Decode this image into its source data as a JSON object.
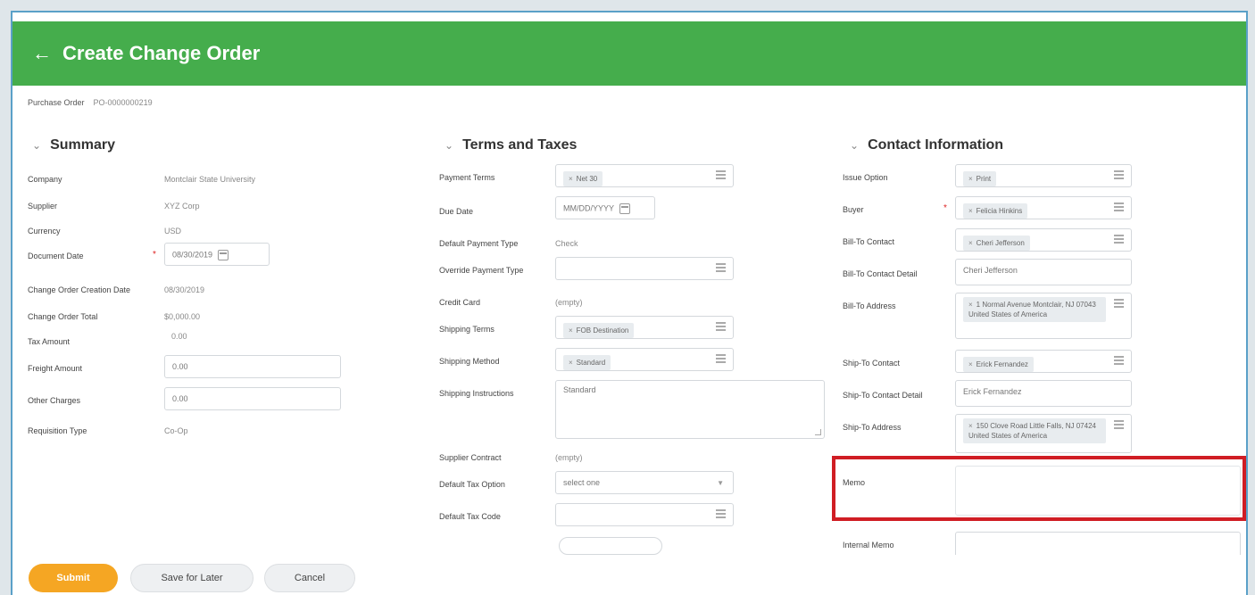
{
  "header": {
    "back_icon": "arrow-left-icon",
    "title": "Create Change Order"
  },
  "purchase_order": {
    "label": "Purchase Order",
    "value": "PO-0000000219"
  },
  "summary": {
    "title": "Summary",
    "company_label": "Company",
    "company_value": "Montclair State University",
    "supplier_label": "Supplier",
    "supplier_value": "XYZ Corp",
    "currency_label": "Currency",
    "currency_value": "USD",
    "document_date_label": "Document Date",
    "document_date_value": "08/30/2019",
    "creation_date_label": "Change Order Creation Date",
    "creation_date_value": "08/30/2019",
    "total_label": "Change Order Total",
    "total_value": "$0,000.00",
    "tax_label": "Tax Amount",
    "tax_value": "0.00",
    "freight_label": "Freight Amount",
    "freight_value": "0.00",
    "other_label": "Other Charges",
    "other_value": "0.00",
    "req_type_label": "Requisition Type",
    "req_type_value": "Co-Op"
  },
  "terms": {
    "title": "Terms and Taxes",
    "payment_terms_label": "Payment Terms",
    "payment_terms_value": "Net 30",
    "due_date_label": "Due Date",
    "due_date_value": "MM/DD/YYYY",
    "default_payment_type_label": "Default Payment Type",
    "default_payment_type_value": "Check",
    "override_payment_type_label": "Override Payment Type",
    "credit_card_label": "Credit Card",
    "credit_card_value": "(empty)",
    "shipping_terms_label": "Shipping Terms",
    "shipping_terms_value": "FOB Destination",
    "shipping_method_label": "Shipping Method",
    "shipping_method_value": "Standard",
    "shipping_instructions_label": "Shipping Instructions",
    "shipping_instructions_value": "Standard",
    "supplier_contract_label": "Supplier Contract",
    "supplier_contract_value": "(empty)",
    "default_tax_option_label": "Default Tax Option",
    "default_tax_option_placeholder": "select one",
    "default_tax_code_label": "Default Tax Code"
  },
  "contact": {
    "title": "Contact Information",
    "issue_option_label": "Issue Option",
    "issue_option_value": "Print",
    "buyer_label": "Buyer",
    "buyer_value": "Felicia Hinkins",
    "bill_to_contact_label": "Bill-To Contact",
    "bill_to_contact_value": "Cheri Jefferson",
    "bill_to_contact_detail_label": "Bill-To Contact Detail",
    "bill_to_contact_detail_value": "Cheri Jefferson",
    "bill_to_address_label": "Bill-To Address",
    "bill_to_address_value": "1 Normal Avenue Montclair, NJ 07043 United States of America",
    "ship_to_contact_label": "Ship-To Contact",
    "ship_to_contact_value": "Erick Fernandez",
    "ship_to_contact_detail_label": "Ship-To Contact Detail",
    "ship_to_contact_detail_value": "Erick Fernandez",
    "ship_to_address_label": "Ship-To Address",
    "ship_to_address_value": "150 Clove Road Little Falls, NJ 07424 United States of America",
    "memo_label": "Memo",
    "internal_memo_label": "Internal Memo"
  },
  "footer": {
    "submit_label": "Submit",
    "save_later_label": "Save for Later",
    "cancel_label": "Cancel"
  },
  "colors": {
    "header": "#45ad4c",
    "primary_button": "#f5a623",
    "highlight": "#d01d24"
  }
}
